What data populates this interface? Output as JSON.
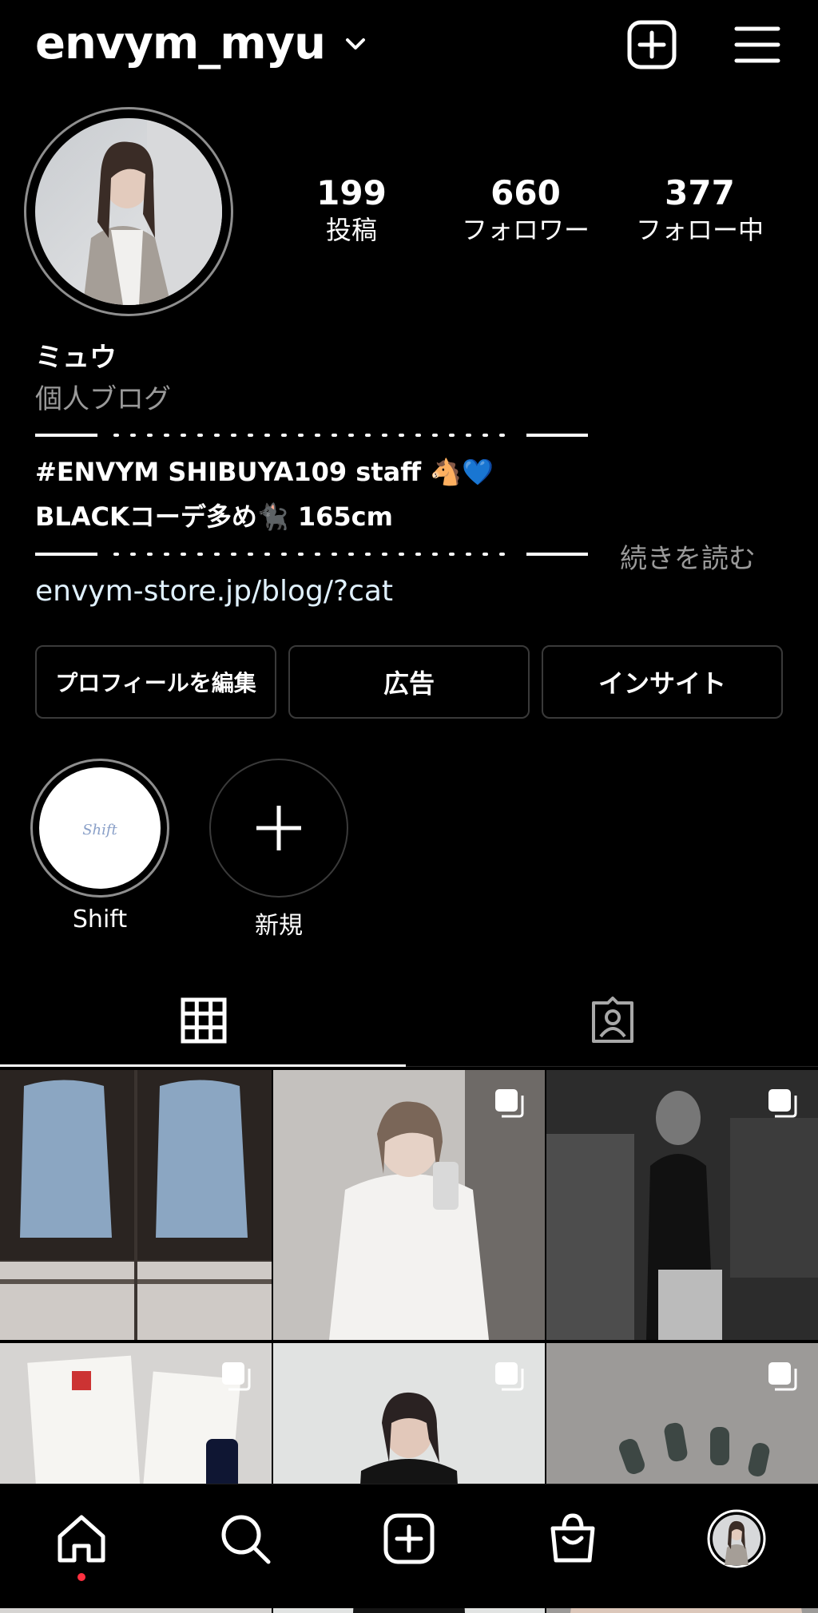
{
  "header": {
    "username": "envym_myu",
    "icons": [
      "chevron-down-icon",
      "new-post-icon",
      "menu-icon"
    ]
  },
  "profile": {
    "stats": [
      {
        "value": "199",
        "label": "投稿"
      },
      {
        "value": "660",
        "label": "フォロワー"
      },
      {
        "value": "377",
        "label": "フォロー中"
      }
    ],
    "display_name": "ミュウ",
    "category": "個人ブログ",
    "bio_line1": "#ENVYM SHIBUYA109 staff 🐴💙",
    "bio_line2": "BLACKコーデ多め🐈‍⬛ 165cm",
    "read_more": "続きを読む",
    "link": "envym-store.jp/blog/?cat"
  },
  "buttons": {
    "edit_profile": "プロフィールを編集",
    "ads": "広告",
    "insights": "インサイト"
  },
  "highlights": [
    {
      "label": "Shift",
      "cover_text": "Shift"
    },
    {
      "label": "新規"
    }
  ],
  "tabs": [
    "grid-icon",
    "tagged-icon"
  ],
  "posts": [
    {
      "desc": "blue hoodie photo collage",
      "multi": false
    },
    {
      "desc": "mirror selfie in white dress",
      "multi": true
    },
    {
      "desc": "dark interior portrait",
      "multi": true
    },
    {
      "desc": "skincare product flatlay",
      "multi": true
    },
    {
      "desc": "portrait on grey background",
      "multi": true
    },
    {
      "desc": "dark grey nails",
      "multi": true
    }
  ],
  "bottom_nav": [
    "home-icon",
    "search-icon",
    "create-icon",
    "shop-icon",
    "profile-avatar"
  ],
  "colors": {
    "background": "#000000",
    "accent_link": "#e0f1ff",
    "notification_dot": "#ff3040",
    "secondary_text": "#9a9a9a"
  }
}
